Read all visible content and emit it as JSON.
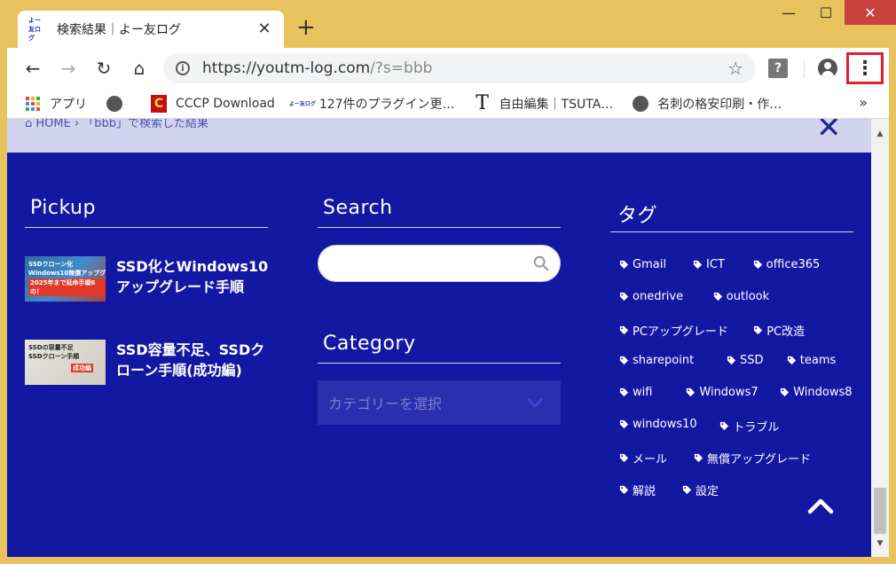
{
  "browser": {
    "tab": {
      "favicon_text": "よー友ログ",
      "title": "検索結果｜よー友ログ",
      "close": "✕"
    },
    "new_tab": "+",
    "window_controls": {
      "minimize": "—",
      "maximize": "☐",
      "close": "✕"
    },
    "toolbar": {
      "back": "←",
      "forward": "→",
      "reload": "↻",
      "home": "⌂",
      "url_host": "https://youtm-log.com",
      "url_path": "/?s=bbb",
      "star": "☆",
      "help": "?",
      "menu": "⋮"
    },
    "bookmarks": {
      "items": [
        {
          "label": "アプリ",
          "icon": "apps-grid-icon"
        },
        {
          "label": "",
          "icon": "globe-icon"
        },
        {
          "label": "CCCP Download",
          "icon": "c-icon",
          "icon_text": "C"
        },
        {
          "label": "127件のプラグイン更…",
          "icon": "youtm-icon",
          "icon_text": "よー友ログ"
        },
        {
          "label": "自由編集｜TSUTA…",
          "icon": "t-icon",
          "icon_text": "T"
        },
        {
          "label": "名刺の格安印刷・作…",
          "icon": "globe-icon"
        }
      ],
      "more": "»"
    }
  },
  "page": {
    "breadcrumb": "⌂ HOME  ›  「bbb」で検索した結果",
    "close_glyph": "✕",
    "pickup": {
      "title": "Pickup",
      "items": [
        {
          "title": "SSD化とWindows10アップグレード手順",
          "thumb_text": "SSDクローン化\nWindows10無償アップグレード",
          "thumb_badge": "2025年まで延命手順6の！"
        },
        {
          "title": "SSD容量不足、SSDクローン手順(成功編)",
          "thumb_text": "SSDの容量不足\nSSDクローン手順",
          "thumb_badge": "成功編"
        }
      ]
    },
    "search": {
      "title": "Search",
      "placeholder": "",
      "value": ""
    },
    "category": {
      "title": "Category",
      "selected": "カテゴリーを選択"
    },
    "tags": {
      "title": "タグ",
      "items": [
        "Gmail",
        "ICT",
        "office365",
        "onedrive",
        "outlook",
        "PCアップグレード",
        "PC改造",
        "sharepoint",
        "SSD",
        "teams",
        "wifi",
        "Windows7",
        "Windows8",
        "windows10",
        "トラブル",
        "メール",
        "無償アップグレード",
        "解説",
        "設定"
      ]
    }
  },
  "colors": {
    "frame": "#e8c25d",
    "page_bg": "#1318a3",
    "highlight": "#e0202a"
  }
}
